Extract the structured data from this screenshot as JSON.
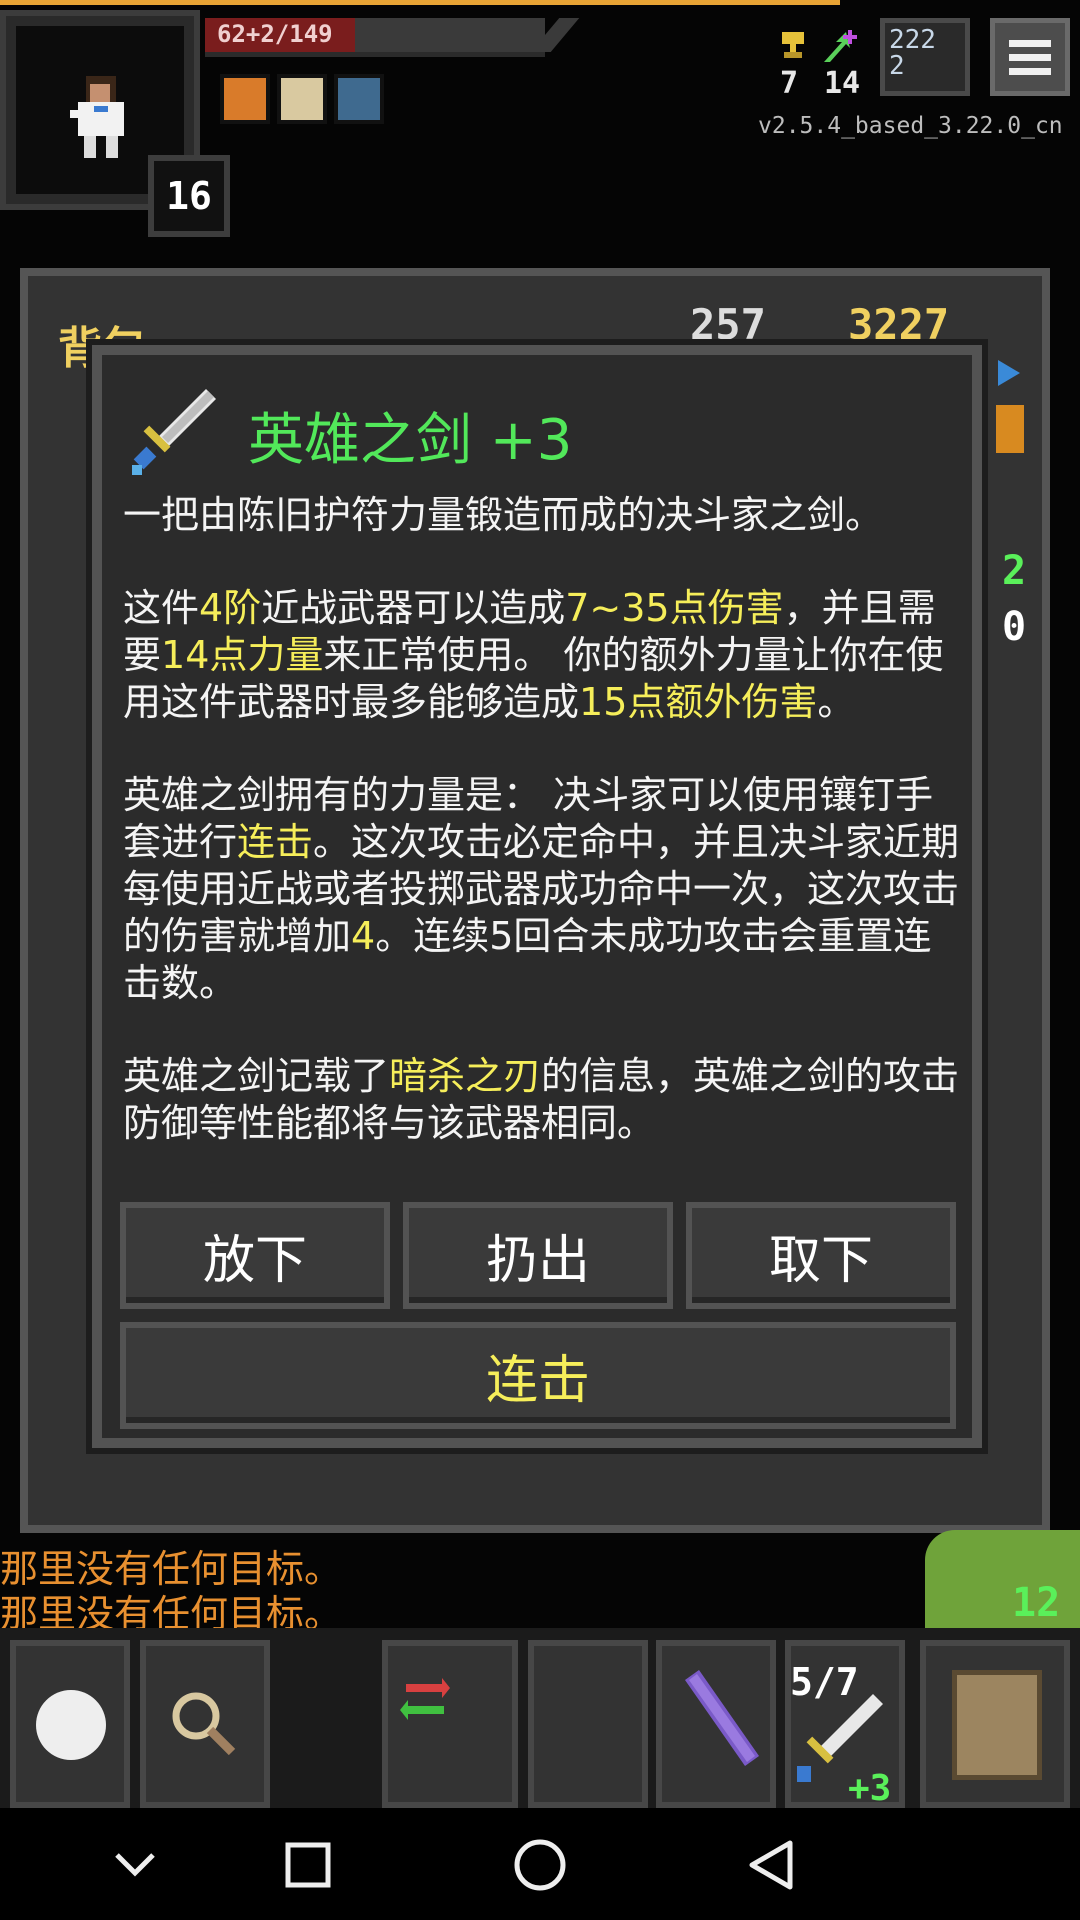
{
  "hud": {
    "level": "16",
    "hp_text": "62+2/149",
    "trophies": "7",
    "upgrades": "14",
    "key_text": "222\n2",
    "version": "v2.5.4_based_3.22.0_cn"
  },
  "backpack": {
    "title": "背包",
    "gold_left": "257",
    "gold_right": "3227",
    "side_numbers": [
      "2",
      "0"
    ]
  },
  "dialog": {
    "item_name": "英雄之剑 +3",
    "line1": "一把由陈旧护符力量锻造而成的决斗家之剑。",
    "p2_a": "这件",
    "p2_tier": "4阶",
    "p2_b": "近战武器可以造成",
    "p2_dmg": "7~35点伤害",
    "p2_c": "，并且需要",
    "p2_str": "14点力量",
    "p2_d": "来正常使用。 你的额外力量让你在使用这件武器时最多能够造成",
    "p2_extra": "15点额外伤害",
    "p2_e": "。",
    "p3_a": "英雄之剑拥有的力量是： 决斗家可以使用镶钉手套进行",
    "p3_combo": "连击",
    "p3_b": "。这次攻击必定命中，并且决斗家近期每使用近战或者投掷武器成功命中一次，这次攻击的伤害就增加",
    "p3_num": "4",
    "p3_c": "。连续5回合未成功攻击会重置连击数。",
    "p4_a": "英雄之剑记载了",
    "p4_weapon": "暗杀之刃",
    "p4_b": "的信息，英雄之剑的攻击防御等性能都将与该武器相同。",
    "btn_drop": "放下",
    "btn_throw": "扔出",
    "btn_unequip": "取下",
    "btn_combo": "连击"
  },
  "log": {
    "line1": "那里没有任何目标。",
    "line2": "那里没有任何目标。"
  },
  "toolbar": {
    "wand_charges": "5/7",
    "sword_bonus": "+3",
    "ally_level": "12"
  },
  "colors": {
    "title_green": "#52e85a",
    "highlight_yellow": "#f6ee5a",
    "log_orange": "#e89030"
  }
}
